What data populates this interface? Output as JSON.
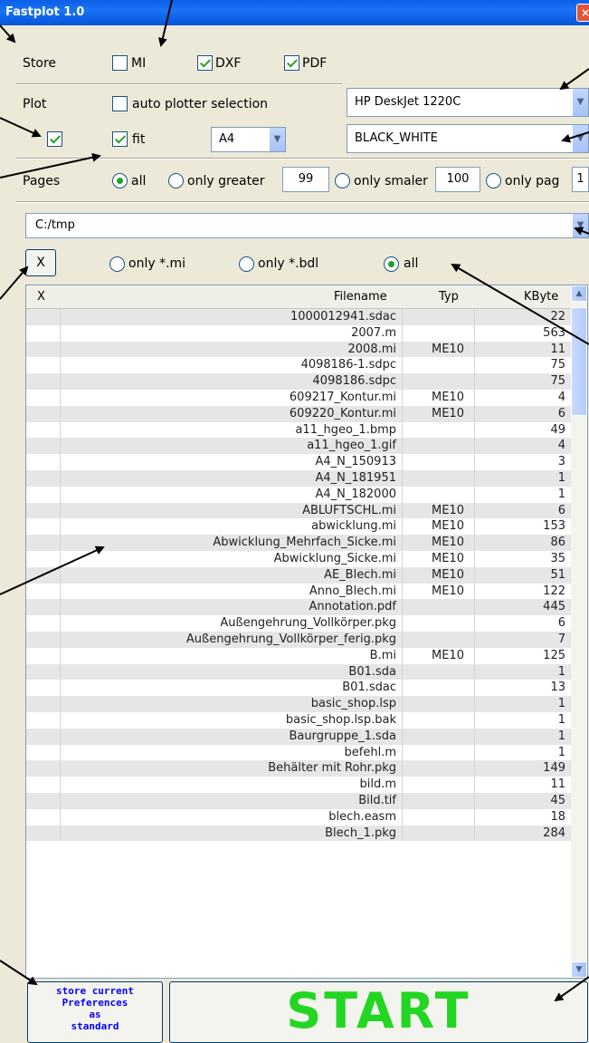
{
  "window": {
    "title": "Fastplot 1.0",
    "close_symbol": "×"
  },
  "store": {
    "label": "Store",
    "options": [
      {
        "label": "MI",
        "checked": false
      },
      {
        "label": "DXF",
        "checked": true
      },
      {
        "label": "PDF",
        "checked": true
      }
    ]
  },
  "plot": {
    "label": "Plot",
    "auto_label": "auto plotter selection",
    "auto_checked": false,
    "plot_checked": true,
    "fit_label": "fit",
    "fit_checked": true,
    "paper_size": "A4",
    "plotter": "HP DeskJet 1220C",
    "color_mode": "BLACK_WHITE"
  },
  "pages": {
    "label": "Pages",
    "all_label": "all",
    "greater_label": "only greater",
    "greater_value": "99",
    "smaller_label": "only smaler",
    "smaller_value": "100",
    "page_label": "only pag",
    "page_value": "1",
    "selected": "all"
  },
  "path": "C:/tmp",
  "filter": {
    "clear_label": "X",
    "mi_label": "only *.mi",
    "bdl_label": "only *.bdl",
    "all_label": "all",
    "selected": "all"
  },
  "table": {
    "headers": {
      "x": "X",
      "filename": "Filename",
      "typ": "Typ",
      "kbyte": "KByte"
    },
    "rows": [
      {
        "name": "1000012941.sdac",
        "typ": "",
        "kb": "22"
      },
      {
        "name": "2007.m",
        "typ": "",
        "kb": "563"
      },
      {
        "name": "2008.mi",
        "typ": "ME10",
        "kb": "11"
      },
      {
        "name": "4098186-1.sdpc",
        "typ": "",
        "kb": "75"
      },
      {
        "name": "4098186.sdpc",
        "typ": "",
        "kb": "75"
      },
      {
        "name": "609217_Kontur.mi",
        "typ": "ME10",
        "kb": "4"
      },
      {
        "name": "609220_Kontur.mi",
        "typ": "ME10",
        "kb": "6"
      },
      {
        "name": "a11_hgeo_1.bmp",
        "typ": "",
        "kb": "49"
      },
      {
        "name": "a11_hgeo_1.gif",
        "typ": "",
        "kb": "4"
      },
      {
        "name": "A4_N_150913",
        "typ": "",
        "kb": "3"
      },
      {
        "name": "A4_N_181951",
        "typ": "",
        "kb": "1"
      },
      {
        "name": "A4_N_182000",
        "typ": "",
        "kb": "1"
      },
      {
        "name": "ABLUFTSCHL.mi",
        "typ": "ME10",
        "kb": "6"
      },
      {
        "name": "abwicklung.mi",
        "typ": "ME10",
        "kb": "153"
      },
      {
        "name": "Abwicklung_Mehrfach_Sicke.mi",
        "typ": "ME10",
        "kb": "86"
      },
      {
        "name": "Abwicklung_Sicke.mi",
        "typ": "ME10",
        "kb": "35"
      },
      {
        "name": "AE_Blech.mi",
        "typ": "ME10",
        "kb": "51"
      },
      {
        "name": "Anno_Blech.mi",
        "typ": "ME10",
        "kb": "122"
      },
      {
        "name": "Annotation.pdf",
        "typ": "",
        "kb": "445"
      },
      {
        "name": "Außengehrung_Vollkörper.pkg",
        "typ": "",
        "kb": "6"
      },
      {
        "name": "Außengehrung_Vollkörper_ferig.pkg",
        "typ": "",
        "kb": "7"
      },
      {
        "name": "B.mi",
        "typ": "ME10",
        "kb": "125"
      },
      {
        "name": "B01.sda",
        "typ": "",
        "kb": "1"
      },
      {
        "name": "B01.sdac",
        "typ": "",
        "kb": "13"
      },
      {
        "name": "basic_shop.lsp",
        "typ": "",
        "kb": "1"
      },
      {
        "name": "basic_shop.lsp.bak",
        "typ": "",
        "kb": "1"
      },
      {
        "name": "Baurgruppe_1.sda",
        "typ": "",
        "kb": "1"
      },
      {
        "name": "befehl.m",
        "typ": "",
        "kb": "1"
      },
      {
        "name": "Behälter mit Rohr.pkg",
        "typ": "",
        "kb": "149"
      },
      {
        "name": "bild.m",
        "typ": "",
        "kb": "11"
      },
      {
        "name": "Bild.tif",
        "typ": "",
        "kb": "45"
      },
      {
        "name": "blech.easm",
        "typ": "",
        "kb": "18"
      },
      {
        "name": "Blech_1.pkg",
        "typ": "",
        "kb": "284"
      }
    ]
  },
  "buttons": {
    "store_pref_lines": [
      "store current",
      "Preferences",
      "as",
      "standard"
    ],
    "start": "START"
  },
  "icons": {
    "dropdown": "▼",
    "scroll_up": "▲",
    "scroll_down": "▼"
  }
}
